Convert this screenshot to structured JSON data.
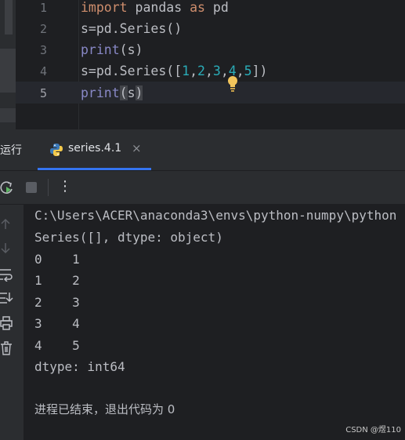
{
  "editor": {
    "lines": [
      {
        "num": "1"
      },
      {
        "num": "2"
      },
      {
        "num": "3"
      },
      {
        "num": "4"
      },
      {
        "num": "5"
      }
    ],
    "tokens": {
      "l1_import": "import",
      "l1_mid": " pandas ",
      "l1_as": "as",
      "l1_end": " pd",
      "l2": "s=pd.Series()",
      "l3_print": "print",
      "l3_rest": "(s)",
      "l4_a": "s=pd.Series([",
      "l4_1": "1",
      "l4_c1": ",",
      "l4_2": "2",
      "l4_c2": ",",
      "l4_3": "3",
      "l4_c3": ",",
      "l4_4": "4",
      "l4_c4": ",",
      "l4_5": "5",
      "l4_z": "])",
      "l5_print": "print",
      "l5_open": "(",
      "l5_s": "s",
      "l5_close": ")"
    },
    "current_line": 5,
    "bulb_icon": "lightbulb-icon"
  },
  "run_panel": {
    "label": "运行",
    "tab_label": "series.4.1",
    "tab_icon": "python-icon",
    "close_glyph": "×",
    "more_glyph": "⋮"
  },
  "console": {
    "lines": [
      "C:\\Users\\ACER\\anaconda3\\envs\\python-numpy\\python",
      "Series([], dtype: object)",
      "0    1",
      "1    2",
      "2    3",
      "3    4",
      "4    5",
      "dtype: int64",
      "",
      "进程已结束，退出代码为 0"
    ]
  },
  "watermark": "CSDN @煜110",
  "colors": {
    "keyword": "#cf8e6d",
    "builtin": "#8888c6",
    "number": "#2aacb8",
    "accent": "#3574f0"
  }
}
